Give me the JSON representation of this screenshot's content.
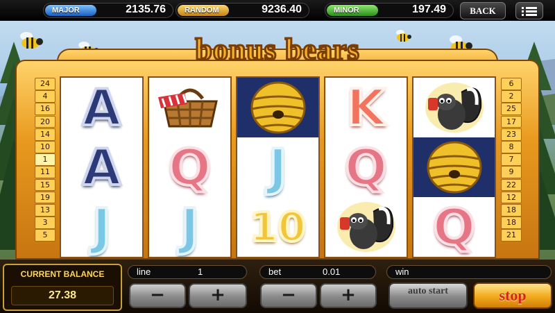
{
  "jackpots": [
    {
      "label": "MAJOR",
      "value": "2135.76"
    },
    {
      "label": "RANDOM",
      "value": "9236.40"
    },
    {
      "label": "MINOR",
      "value": "197.49"
    }
  ],
  "header": {
    "back_label": "BACK",
    "menu_icon": "hamburger-menu-icon"
  },
  "logo": {
    "text": "bonus bears"
  },
  "paylines": {
    "left": [
      "24",
      "4",
      "16",
      "20",
      "14",
      "10",
      "1",
      "11",
      "15",
      "19",
      "13",
      "3",
      "5"
    ],
    "right": [
      "6",
      "2",
      "25",
      "17",
      "23",
      "8",
      "7",
      "9",
      "22",
      "12",
      "18",
      "18",
      "21"
    ],
    "active": "1"
  },
  "reels": [
    [
      "A",
      "A",
      "J"
    ],
    [
      "picnic-basket",
      "Q",
      "J"
    ],
    [
      "beehive",
      "J",
      "10"
    ],
    [
      "K",
      "Q",
      "skunk"
    ],
    [
      "skunk",
      "beehive",
      "Q"
    ]
  ],
  "balance": {
    "label": "CURRENT BALANCE",
    "value": "27.38"
  },
  "controls": {
    "line_label": "line",
    "line_value": "1",
    "bet_label": "bet",
    "bet_value": "0.01",
    "win_label": "win",
    "minus": "−",
    "plus": "+",
    "auto_start_label": "auto start",
    "stop_label": "stop"
  }
}
